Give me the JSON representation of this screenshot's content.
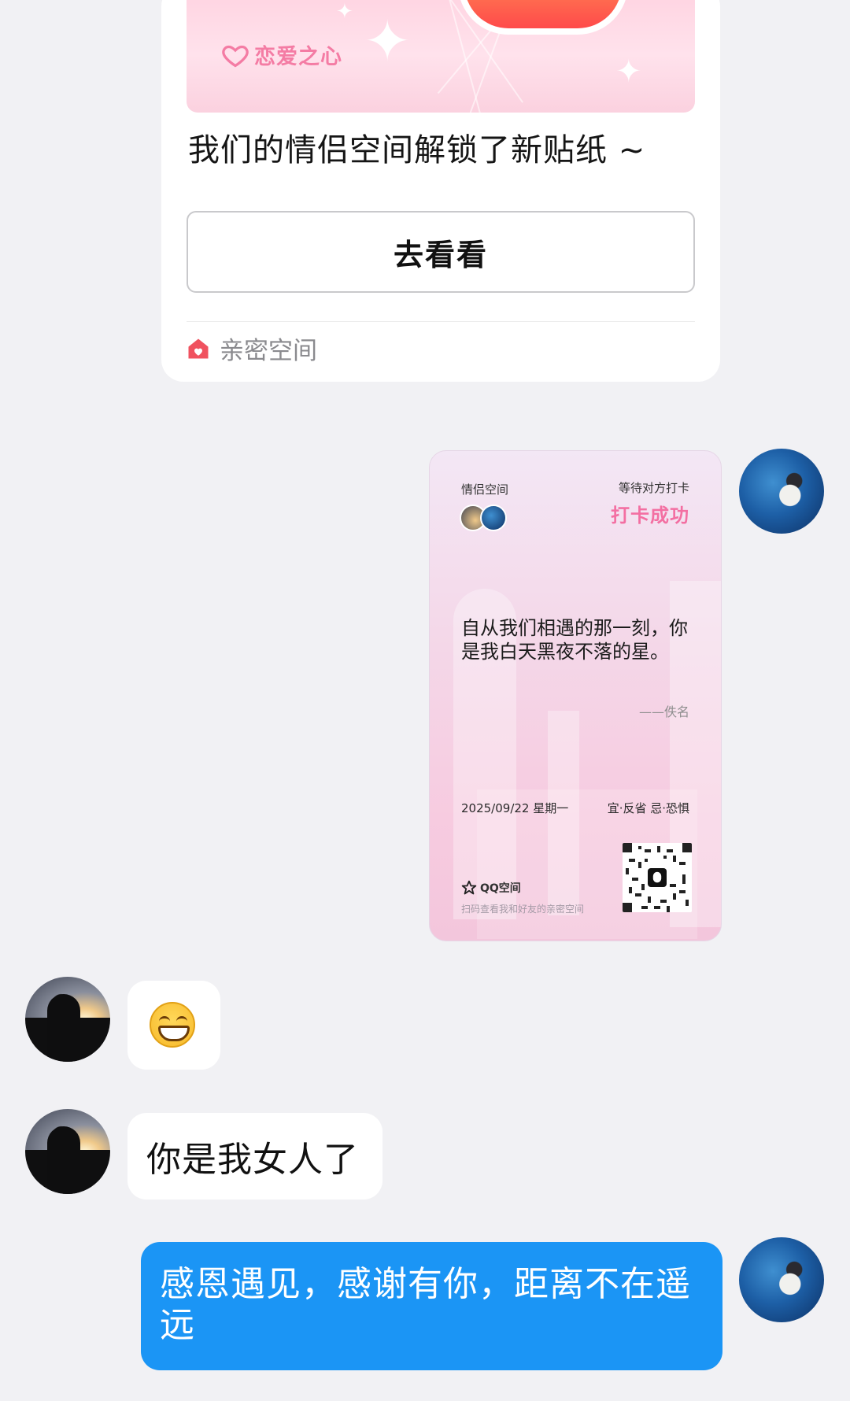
{
  "sticker_card": {
    "banner_label": "恋爱之心",
    "message": "我们的情侣空间解锁了新贴纸 ~",
    "button_label": "去看看",
    "source": "亲密空间"
  },
  "checkin_card": {
    "space_label": "情侣空间",
    "waiting_label": "等待对方打卡",
    "status": "打卡成功",
    "quote": "自从我们相遇的那一刻，你是我白天黑夜不落的星。",
    "author": "——佚名",
    "date": "2025/09/22 星期一",
    "almanac": "宜·反省 忌·恐惧",
    "brand": "QQ空间",
    "scan_hint": "扫码查看我和好友的亲密空间"
  },
  "messages": [
    {
      "from": "other",
      "type": "emoji",
      "emoji": "grinning-face"
    },
    {
      "from": "other",
      "type": "text",
      "text": "你是我女人了"
    },
    {
      "from": "me",
      "type": "text",
      "text": "感恩遇见，感谢有你，距离不在遥远"
    }
  ],
  "colors": {
    "accent_blue": "#1b95f5",
    "success_pink": "#f36fa2",
    "background": "#f1f1f4"
  }
}
